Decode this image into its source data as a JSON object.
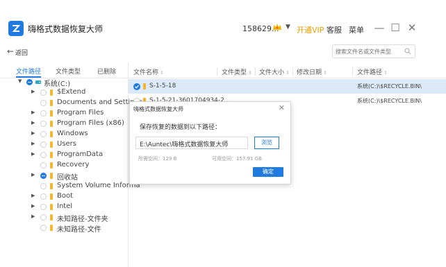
{
  "app": {
    "title": "嗨格式数据恢复大师",
    "user_id": "158629...",
    "vip_caret": "▼",
    "vip_label": "开通VIP",
    "tc_label": "客服",
    "menu_label": "菜单",
    "minimize": "—",
    "maximize": "☐",
    "close": "✕",
    "accent_color": "#1f7be0",
    "vip_color": "#f0a000"
  },
  "toolbar": {
    "back_label": "返回",
    "search_placeholder": "搜索文件名或文件类型"
  },
  "left_panel": {
    "tabs": [
      {
        "label": "文件路径",
        "active": true
      },
      {
        "label": "文件类型",
        "active": false
      },
      {
        "label": "已删除",
        "active": false
      }
    ],
    "tree": [
      {
        "label": "系统(C:)",
        "expanded": true,
        "checked": "partial",
        "icon": "drive-icon"
      },
      {
        "label": "$Extend",
        "has_children": true
      },
      {
        "label": "Documents and Settings",
        "has_children": false
      },
      {
        "label": "Program Files",
        "has_children": true
      },
      {
        "label": "Program Files (x86)",
        "has_children": true
      },
      {
        "label": "Windows",
        "has_children": true
      },
      {
        "label": "Users",
        "has_children": true
      },
      {
        "label": "ProgramData",
        "has_children": true
      },
      {
        "label": "Recovery",
        "has_children": false
      },
      {
        "label": "回收站",
        "has_children": true,
        "checked": "partial"
      },
      {
        "label": "System Volume Informa",
        "has_children": false
      },
      {
        "label": "Boot",
        "has_children": true
      },
      {
        "label": "Intel",
        "has_children": true
      },
      {
        "label": "未知路径-文件夹",
        "has_children": true
      },
      {
        "label": "未知路径-文件",
        "has_children": false
      }
    ]
  },
  "file_list": {
    "columns": [
      "文件名称",
      "文件类型",
      "文件大小",
      "修改日期",
      "文件路径"
    ],
    "rows": [
      {
        "name": "S-1-5-18",
        "path": "系统(C:)\\$RECYCLE.BIN\\",
        "checked": true
      },
      {
        "name": "S-1-5-21-3601704934-2...",
        "path": "系统(C:)\\$RECYCLE.BIN\\",
        "checked": false
      }
    ]
  },
  "dialog": {
    "title": "嗨格式数据恢复大师",
    "close": "✕",
    "prompt": "保存恢复的数据到以下路径：",
    "path": "E:\\Auntec\\嗨格式数据恢复大师",
    "browse": "浏览",
    "required": "所需空间：129 B",
    "available": "可用空间：157.91 GB",
    "ok": "确定"
  }
}
